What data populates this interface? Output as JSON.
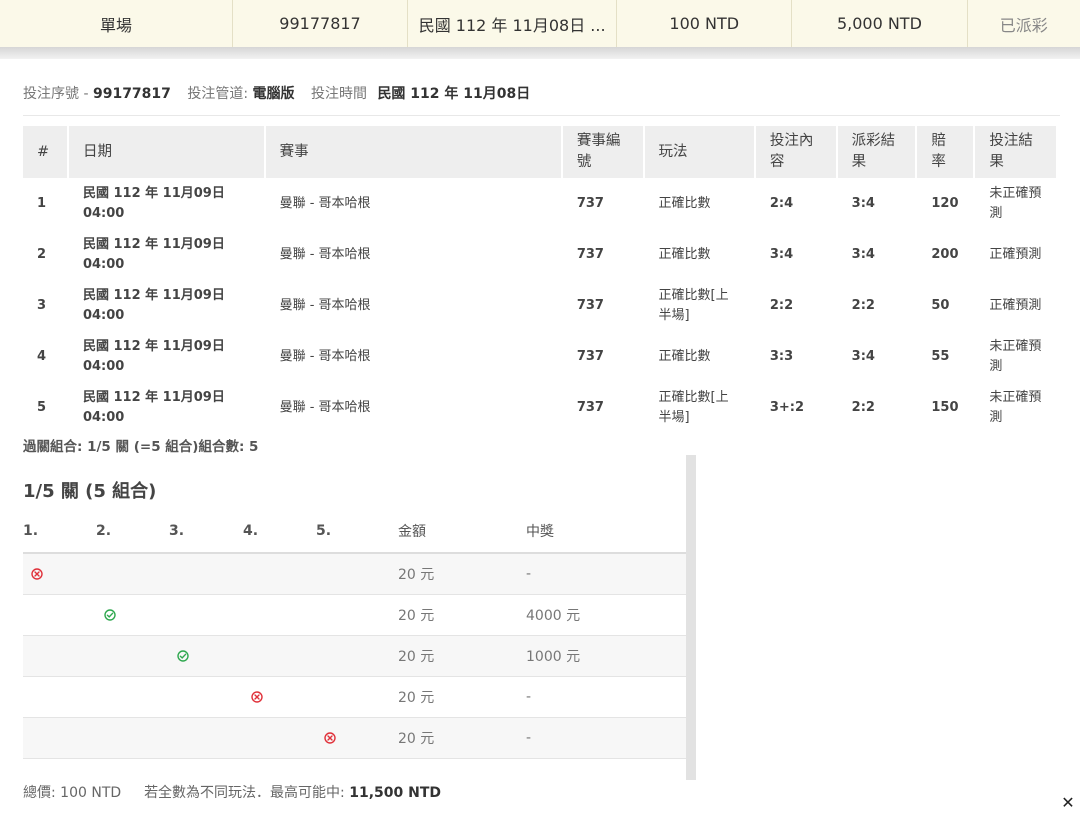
{
  "summary": {
    "type": "單場",
    "ticket_no": "99177817",
    "date": "民國 112 年 11月08日 ...",
    "stake": "100 NTD",
    "potential": "5,000 NTD",
    "status": "已派彩"
  },
  "info": {
    "serial_label": "投注序號 -",
    "serial_value": "99177817",
    "channel_label": "投注管道:",
    "channel_value": "電腦版",
    "time_label": "投注時間",
    "time_value": "民國 112 年 11月08日"
  },
  "detail": {
    "headers": {
      "num": "#",
      "date": "日期",
      "match": "賽事",
      "match_no": "賽事編號",
      "play": "玩法",
      "bet": "投注內容",
      "result": "派彩結果",
      "odds": "賠率",
      "outcome": "投注結果"
    },
    "rows": [
      {
        "num": "1",
        "date": "民國 112 年 11月09日 04:00",
        "match": "曼聯 - 哥本哈根",
        "match_no": "737",
        "play": "正確比數",
        "bet": "2:4",
        "result": "3:4",
        "odds": "120",
        "outcome": "未正確預測"
      },
      {
        "num": "2",
        "date": "民國 112 年 11月09日 04:00",
        "match": "曼聯 - 哥本哈根",
        "match_no": "737",
        "play": "正確比數",
        "bet": "3:4",
        "result": "3:4",
        "odds": "200",
        "outcome": "正確預測"
      },
      {
        "num": "3",
        "date": "民國 112 年 11月09日 04:00",
        "match": "曼聯 - 哥本哈根",
        "match_no": "737",
        "play": "正確比數[上半場]",
        "bet": "2:2",
        "result": "2:2",
        "odds": "50",
        "outcome": "正確預測"
      },
      {
        "num": "4",
        "date": "民國 112 年 11月09日 04:00",
        "match": "曼聯 - 哥本哈根",
        "match_no": "737",
        "play": "正確比數",
        "bet": "3:3",
        "result": "3:4",
        "odds": "55",
        "outcome": "未正確預測"
      },
      {
        "num": "5",
        "date": "民國 112 年 11月09日 04:00",
        "match": "曼聯 - 哥本哈根",
        "match_no": "737",
        "play": "正確比數[上半場]",
        "bet": "3+:2",
        "result": "2:2",
        "odds": "150",
        "outcome": "未正確預測"
      }
    ]
  },
  "combo_line": "過關組合: 1/5 關 (=5 組合)組合數: 5",
  "combo": {
    "title": "1/5 關 (5 組合)",
    "headers": {
      "c1": "1.",
      "c2": "2.",
      "c3": "3.",
      "c4": "4.",
      "c5": "5.",
      "amount": "金額",
      "prize": "中獎"
    },
    "rows": [
      {
        "col": 1,
        "status": "lose",
        "amount": "20 元",
        "prize": "-"
      },
      {
        "col": 2,
        "status": "win",
        "amount": "20 元",
        "prize": "4000 元"
      },
      {
        "col": 3,
        "status": "win",
        "amount": "20 元",
        "prize": "1000 元"
      },
      {
        "col": 4,
        "status": "lose",
        "amount": "20 元",
        "prize": "-"
      },
      {
        "col": 5,
        "status": "lose",
        "amount": "20 元",
        "prize": "-"
      }
    ],
    "win_color": "#2fa84f",
    "lose_color": "#e0313a"
  },
  "footer": {
    "total_label": "總價:",
    "total_value": "100 NTD",
    "note": "若全數為不同玩法．最高可能中:",
    "max_value": "11,500 NTD"
  },
  "close_icon": "close-icon"
}
